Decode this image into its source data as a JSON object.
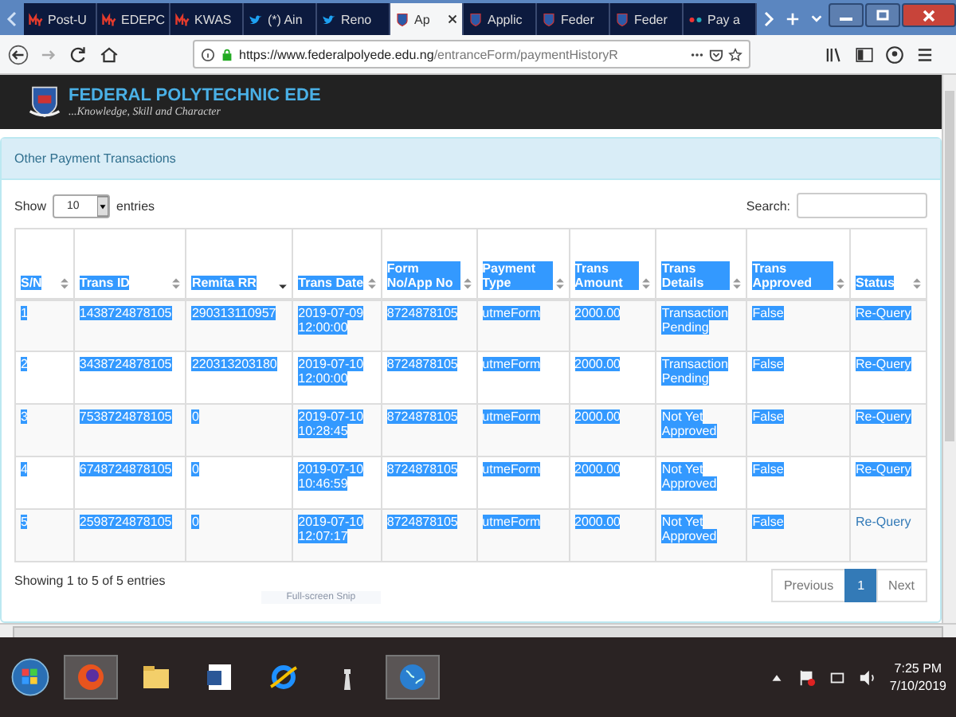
{
  "browser": {
    "tabs": [
      {
        "kind": "my",
        "label": "Post-U",
        "selected": false
      },
      {
        "kind": "my",
        "label": "EDEPC",
        "selected": false
      },
      {
        "kind": "my",
        "label": "KWAS",
        "selected": false
      },
      {
        "kind": "bird",
        "label": "(*) Ain",
        "selected": false
      },
      {
        "kind": "bird",
        "label": "Reno",
        "selected": false
      },
      {
        "kind": "crest",
        "label": "Ap",
        "selected": true
      },
      {
        "kind": "crest",
        "label": "Applic",
        "selected": false
      },
      {
        "kind": "crest",
        "label": "Feder",
        "selected": false
      },
      {
        "kind": "crest",
        "label": "Feder",
        "selected": false
      },
      {
        "kind": "dots",
        "label": "Pay a",
        "selected": false
      }
    ],
    "url_host": "https://www.federalpolyede.edu.ng",
    "url_path": "/entranceForm/paymentHistoryR"
  },
  "site": {
    "title": "FEDERAL POLYTECHNIC EDE",
    "motto": "...Knowledge, Skill and Character"
  },
  "panel": {
    "heading": "Other Payment Transactions",
    "show_label": "Show",
    "page_size": "10",
    "entries_label": "entries",
    "search_label": "Search:",
    "table": {
      "headers_highlighted": true,
      "columns": [
        "S/N",
        "Trans ID",
        "Remita RR",
        "Trans Date",
        "Form No/App No",
        "Payment Type",
        "Trans Amount",
        "Trans Details",
        "Trans Approved",
        "Status"
      ],
      "rows": [
        {
          "cells": [
            "1",
            "1438724878105",
            "290313110957",
            "2019-07-09 12:00:00",
            "8724878105",
            "utmeForm",
            "2000.00",
            "Transaction Pending",
            "False",
            "Re-Query"
          ],
          "status_highlighted": true
        },
        {
          "cells": [
            "2",
            "3438724878105",
            "220313203180",
            "2019-07-10 12:00:00",
            "8724878105",
            "utmeForm",
            "2000.00",
            "Transaction Pending",
            "False",
            "Re-Query"
          ],
          "status_highlighted": true
        },
        {
          "cells": [
            "3",
            "7538724878105",
            "0",
            "2019-07-10 10:28:45",
            "8724878105",
            "utmeForm",
            "2000.00",
            "Not Yet Approved",
            "False",
            "Re-Query"
          ],
          "status_highlighted": true
        },
        {
          "cells": [
            "4",
            "6748724878105",
            "0",
            "2019-07-10 10:46:59",
            "8724878105",
            "utmeForm",
            "2000.00",
            "Not Yet Approved",
            "False",
            "Re-Query"
          ],
          "status_highlighted": true
        },
        {
          "cells": [
            "5",
            "2598724878105",
            "0",
            "2019-07-10 12:07:17",
            "8724878105",
            "utmeForm",
            "2000.00",
            "Not Yet Approved",
            "False",
            "Re-Query"
          ],
          "status_highlighted": false
        }
      ]
    },
    "info": "Showing 1 to 5 of 5 entries",
    "pages": [
      {
        "label": "Previous",
        "selected": false
      },
      {
        "label": "1",
        "selected": true
      },
      {
        "label": "Next",
        "selected": false
      }
    ]
  },
  "snip_label": "Full-screen Snip",
  "taskbar": {
    "time": "7:25 PM",
    "date": "7/10/2019"
  }
}
